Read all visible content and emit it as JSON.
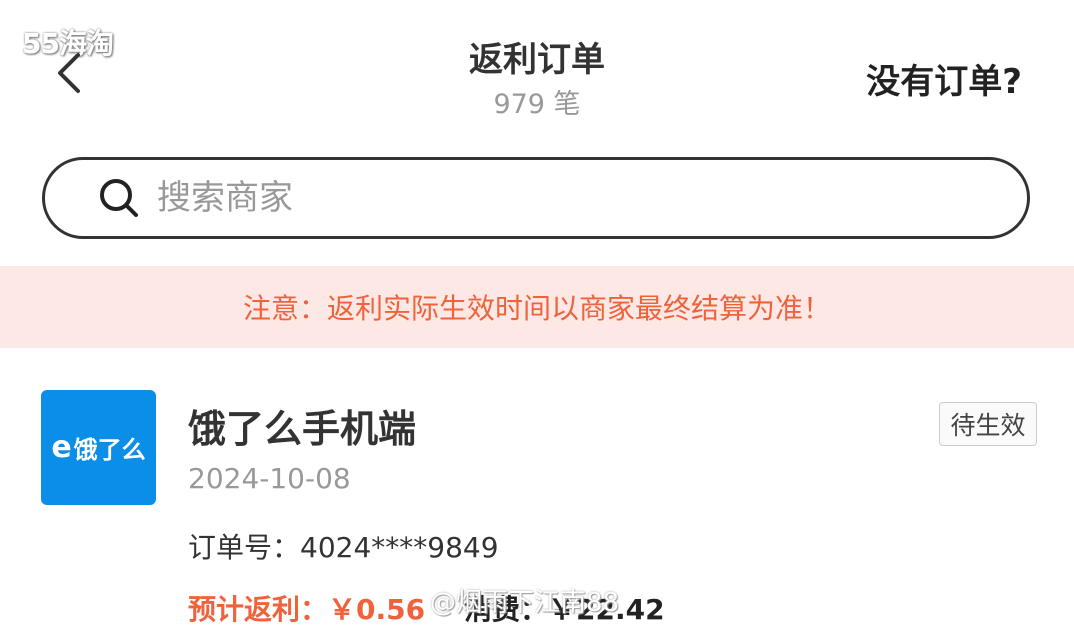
{
  "watermark_top": "55海淘",
  "watermark_bottom": "@烟雨下江南88",
  "header": {
    "title": "返利订单",
    "subtitle": "979 笔",
    "right_link": "没有订单?"
  },
  "search": {
    "placeholder": "搜索商家"
  },
  "notice": "注意：返利实际生效时间以商家最终结算为准！",
  "order": {
    "logo_text": "饿了么",
    "logo_mark": "e",
    "store_name": "饿了么手机端",
    "status": "待生效",
    "date": "2024-10-08",
    "order_no": "订单号：4024****9849",
    "rebate": "预计返利：￥0.56",
    "consume": "消费：￥22.42"
  },
  "colors": {
    "accent": "#f0623c",
    "notice_bg": "#fde8e5",
    "logo_bg": "#0a8ee8"
  }
}
